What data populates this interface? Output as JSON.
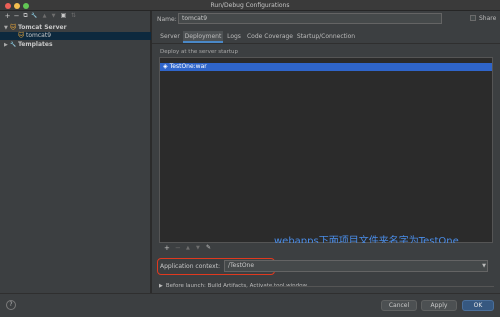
{
  "window": {
    "title": "Run/Debug Configurations"
  },
  "left_toolbar": {
    "add": "+",
    "remove": "−",
    "copy": "⧉",
    "wrench": "🔧",
    "up": "▲",
    "down": "▼",
    "folder": "▣",
    "sort": "⇅"
  },
  "tree": {
    "items": [
      {
        "label": "Tomcat Server",
        "arrow": "▼",
        "icon": "tomcat-icon",
        "glyph": "🐱",
        "level": 0,
        "bold": true
      },
      {
        "label": "tomcat9",
        "arrow": "",
        "icon": "tomcat-icon",
        "glyph": "🐱",
        "level": 1,
        "selected": true
      },
      {
        "label": "Templates",
        "arrow": "▶",
        "icon": "wrench-icon",
        "glyph": "🔧",
        "level": 0,
        "bold": true
      }
    ]
  },
  "config": {
    "name_label": "Name:",
    "name_value": "tomcat9",
    "share_label": "Share"
  },
  "tabs": [
    {
      "label": "Server",
      "active": false
    },
    {
      "label": "Deployment",
      "active": true
    },
    {
      "label": "Logs",
      "active": false
    },
    {
      "label": "Code Coverage",
      "active": false
    },
    {
      "label": "Startup/Connection",
      "active": false
    }
  ],
  "deployment": {
    "section_label": "Deploy at the server startup",
    "items": [
      {
        "label": "TestOne:war",
        "icon": "artifact-icon",
        "glyph": "◈"
      }
    ],
    "annotation": "webapps下面项目文件夹名字为TestOne",
    "toolbar": {
      "add": "+",
      "remove": "−",
      "up": "▲",
      "down": "▼",
      "edit": "✎"
    },
    "app_context_label": "Application context:",
    "app_context_value": "/TestOne",
    "dropdown_glyph": "▼"
  },
  "before_launch": {
    "arrow": "▶",
    "text": "Before launch: Build Artifacts, Activate tool window"
  },
  "buttons": {
    "help": "?",
    "cancel": "Cancel",
    "apply": "Apply",
    "ok": "OK"
  },
  "colors": {
    "accent": "#4a88c7",
    "selection": "#2f65ca",
    "highlight": "#e0391f",
    "annotation": "#4a8de8"
  }
}
